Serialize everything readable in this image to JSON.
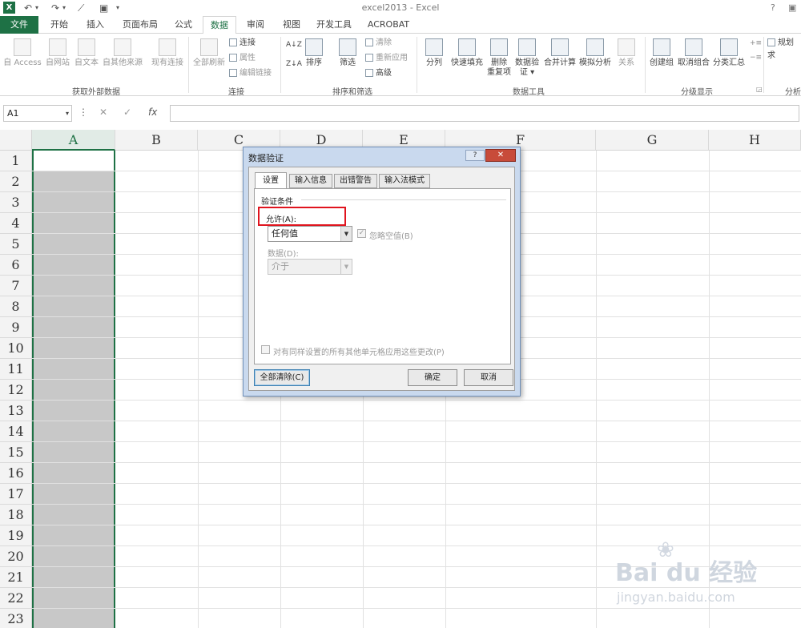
{
  "titlebar": {
    "app_icon_text": "X",
    "title": "excel2013 - Excel",
    "help": "?",
    "undo_glyph": "↶",
    "redo_glyph": "↷",
    "save_glyph": "▣",
    "customize_glyph": "▾"
  },
  "tabs": [
    "文件",
    "开始",
    "插入",
    "页面布局",
    "公式",
    "数据",
    "审阅",
    "视图",
    "开发工具",
    "ACROBAT"
  ],
  "active_tab": "数据",
  "ribbon": {
    "get_external": {
      "group_label": "获取外部数据",
      "items": [
        "自 Access",
        "自网站",
        "自文本",
        "自其他来源",
        "现有连接"
      ]
    },
    "connections": {
      "group_label": "连接",
      "refresh_all": "全部刷新",
      "small": [
        "连接",
        "属性",
        "编辑链接"
      ]
    },
    "sort_filter": {
      "group_label": "排序和筛选",
      "sort_az": "A↓Z",
      "sort": "排序",
      "filter": "筛选",
      "small": [
        "清除",
        "重新应用",
        "高级"
      ]
    },
    "data_tools": {
      "group_label": "数据工具",
      "items": [
        "分列",
        "快速填充",
        "删除\n重复项",
        "数据验\n证 ▾",
        "合并计算",
        "模拟分析",
        "关系"
      ]
    },
    "outline": {
      "group_label": "分级显示",
      "items": [
        "创建组",
        "取消组合",
        "分类汇总"
      ]
    },
    "analysis": {
      "group_label": "分析",
      "solver": "规划求"
    }
  },
  "formula_bar": {
    "name_box": "A1",
    "cancel": "✕",
    "enter": "✓",
    "fx": "fx",
    "colon": "⋮",
    "value": ""
  },
  "grid": {
    "columns": [
      "A",
      "B",
      "C",
      "D",
      "E",
      "F",
      "G",
      "H"
    ],
    "rows": [
      "1",
      "2",
      "3",
      "4",
      "5",
      "6",
      "7",
      "8",
      "9",
      "10",
      "11",
      "12",
      "13",
      "14",
      "15",
      "16",
      "17",
      "18",
      "19",
      "20",
      "21",
      "22",
      "23"
    ],
    "selected_column": "A",
    "active_cell": "A1"
  },
  "dialog": {
    "title": "数据验证",
    "help": "?",
    "close": "✕",
    "tabs": [
      "设置",
      "输入信息",
      "出错警告",
      "输入法模式"
    ],
    "active_tab": "设置",
    "section_label": "验证条件",
    "allow_label": "允许(A):",
    "allow_value": "任何值",
    "ignore_blank_label": "忽略空值(B)",
    "ignore_blank_checked": true,
    "data_label": "数据(D):",
    "data_value": "介于",
    "apply_all_label": "对有同样设置的所有其他单元格应用这些更改(P)",
    "clear_all": "全部清除(C)",
    "ok": "确定",
    "cancel": "取消",
    "highlight_color": "#e0141e"
  },
  "watermark": {
    "logo": "Bai du 经验",
    "url": "jingyan.baidu.com"
  },
  "colors": {
    "excel_green": "#1e7145",
    "selected_column_fill": "#c8c8c8"
  }
}
